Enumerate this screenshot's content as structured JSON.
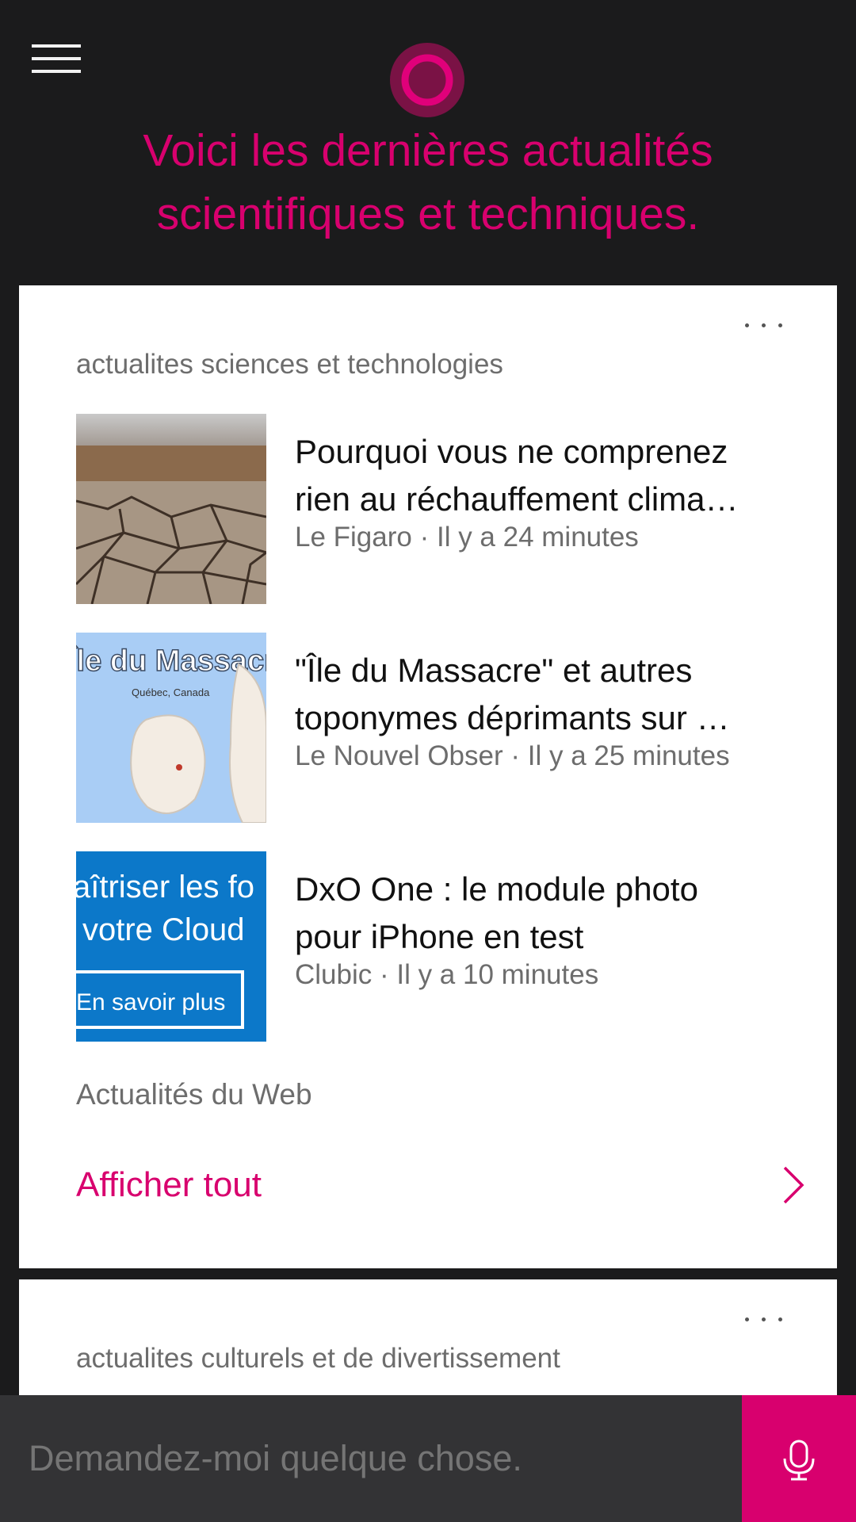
{
  "header": {
    "headline_line1": "Voici les dernières actualités",
    "headline_line2": "scientifiques et techniques."
  },
  "icons": {
    "menu": "hamburger-menu-icon",
    "assistant": "cortana-circle-icon",
    "more": "more-ellipsis-icon",
    "chevron": "chevron-right-icon",
    "mic": "microphone-icon"
  },
  "colors": {
    "accent": "#d8006e",
    "background": "#1b1b1c",
    "card": "#ffffff",
    "search_bar": "#333335"
  },
  "science_card": {
    "heading": "actualites sciences et technologies",
    "articles": [
      {
        "title_line1": "Pourquoi vous ne comprenez",
        "title_line2": "rien au réchauffement clima…",
        "meta": "Le Figaro · Il y a 24 minutes"
      },
      {
        "title_line1": "\"Île du Massacre\" et autres",
        "title_line2": "toponymes déprimants sur …",
        "meta": "Le Nouvel Obser · Il y a 25 minutes",
        "thumb_text_line1": "Île du Massacre",
        "thumb_text_line2": "Québec, Canada"
      },
      {
        "title_line1": "DxO One : le module photo",
        "title_line2": "pour iPhone en test",
        "meta": "Clubic · Il y a 10 minutes",
        "thumb_text_line1": "aîtriser les fo",
        "thumb_text_line2": "votre Cloud",
        "thumb_text_line3": "En savoir plus"
      }
    ],
    "source_label": "Actualités du Web",
    "show_all_label": "Afficher tout"
  },
  "culture_card": {
    "heading": "actualites culturels et de divertissement"
  },
  "search": {
    "placeholder": "Demandez-moi quelque chose."
  }
}
